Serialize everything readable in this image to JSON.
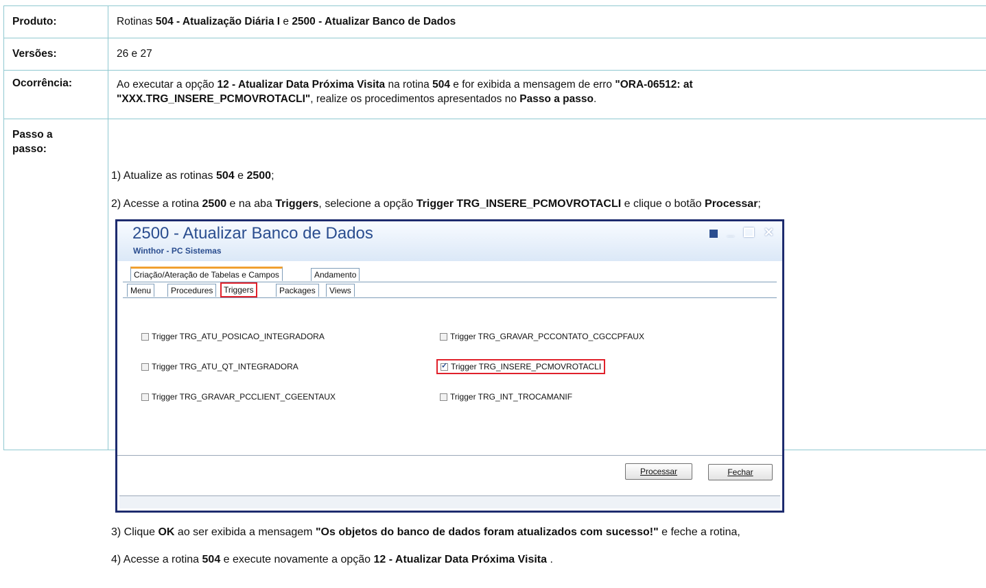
{
  "rows": {
    "produto": {
      "label": "Produto:",
      "value_parts": [
        "Rotinas ",
        "504 - Atualização Diária I",
        " e ",
        "2500 - Atualizar Banco de Dados"
      ]
    },
    "versoes": {
      "label": "Versões:",
      "value": "26 e 27"
    },
    "ocorrencia": {
      "label": "Ocorrência:",
      "parts": [
        "Ao executar a opção ",
        "12 - Atualizar Data Próxima Visita",
        " na rotina ",
        "504",
        " e for exibida a mensagem de erro ",
        "\"ORA-06512: at",
        "\"XXX.TRG_INSERE_PCMOVROTACLI\"",
        ", realize os procedimentos apresentados no ",
        "Passo a passo",
        "."
      ]
    },
    "passo": {
      "label_line1": "Passo a",
      "label_line2": "passo:",
      "step1": [
        "1) Atualize as rotinas ",
        "504",
        " e ",
        "2500",
        ";"
      ],
      "step2": [
        "2) Acesse a rotina ",
        "2500",
        " e na aba ",
        "Triggers",
        ", selecione a opção ",
        "Trigger TRG_INSERE_PCMOVROTACLI",
        " e clique o botão ",
        "Processar",
        ";"
      ],
      "step3": [
        "3) Clique ",
        "OK",
        " ao ser exibida a mensagem ",
        "\"Os objetos do banco de dados foram atualizados com sucesso!\"",
        " e feche a rotina,"
      ],
      "step4": [
        "4) Acesse a rotina ",
        "504",
        " e execute novamente a opção ",
        "12 - Atualizar Data Próxima Visita",
        " ."
      ]
    }
  },
  "window": {
    "title": "2500 - Atualizar Banco de Dados",
    "subtitle": "Winthor - PC Sistemas",
    "min_glyph": "_",
    "close_glyph": "✕",
    "top_tabs": [
      "Criação/Ateração de Tabelas e Campos",
      "Andamento"
    ],
    "sub_tabs": [
      "Menu",
      "Procedures",
      "Triggers",
      "Packages",
      "Views"
    ],
    "triggers_left": [
      "Trigger TRG_ATU_POSICAO_INTEGRADORA",
      "Trigger TRG_ATU_QT_INTEGRADORA",
      "Trigger TRG_GRAVAR_PCCLIENT_CGEENTAUX"
    ],
    "triggers_right": [
      "Trigger TRG_GRAVAR_PCCONTATO_CGCCPFAUX",
      "Trigger TRG_INSERE_PCMOVROTACLI",
      "Trigger TRG_INT_TROCAMANIF"
    ],
    "checked_trigger": "Trigger TRG_INSERE_PCMOVROTACLI",
    "btn_processar": "Processar",
    "btn_fechar": "Fechar",
    "highlight_color": "#e0202a"
  }
}
